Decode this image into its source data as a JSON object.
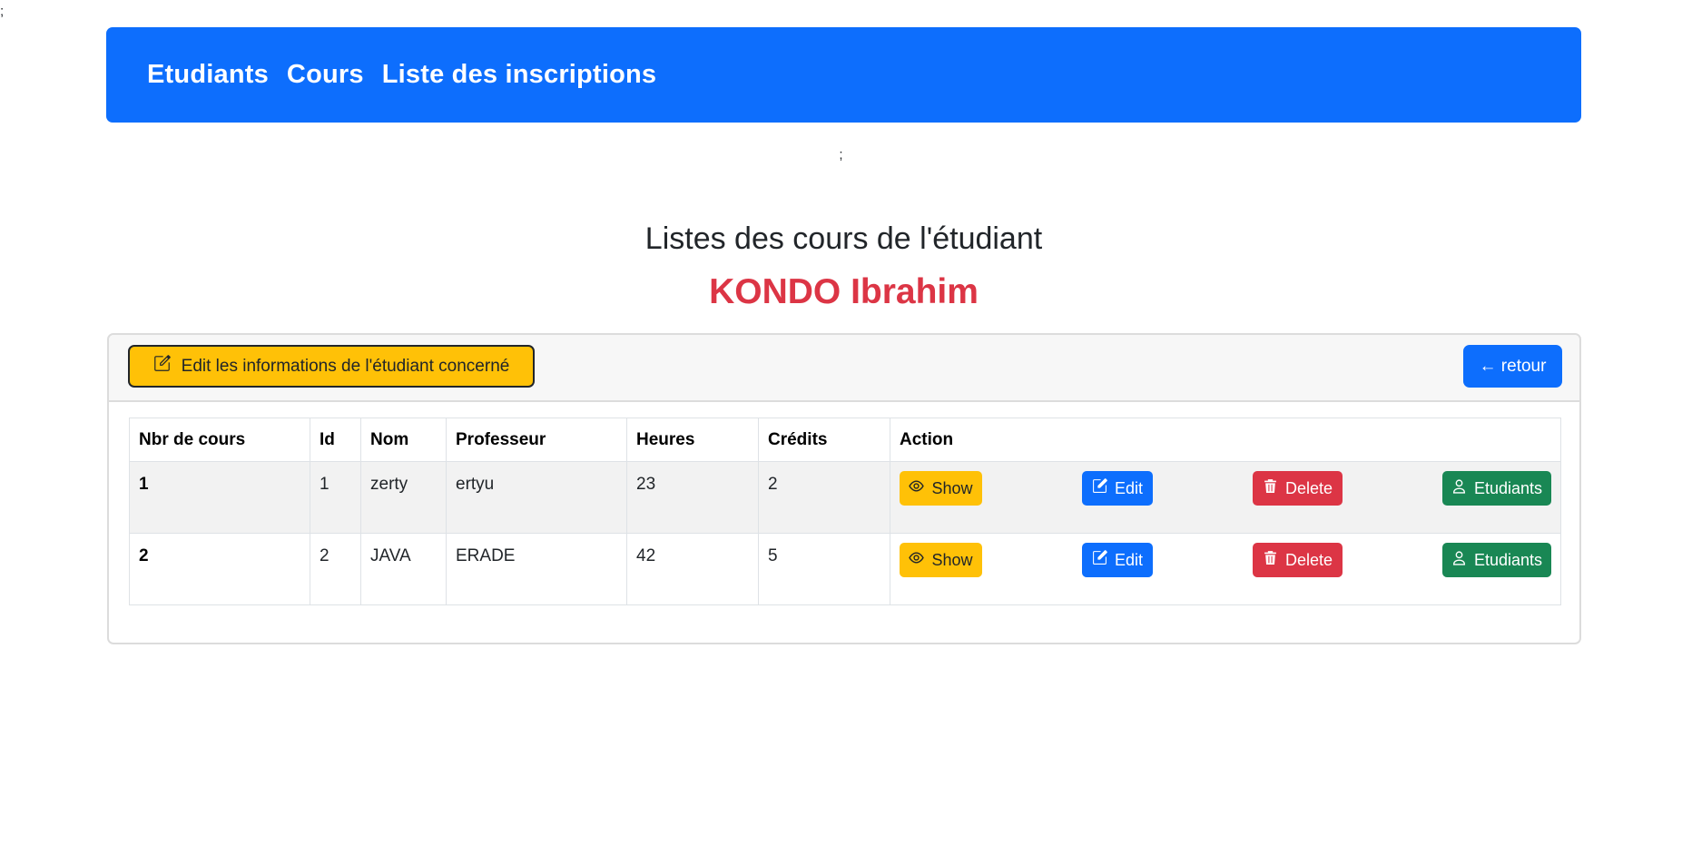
{
  "stray_marks": {
    "top_left": ";",
    "below_nav": ";"
  },
  "navbar": {
    "links": [
      "Etudiants",
      "Cours",
      "Liste des inscriptions"
    ]
  },
  "page": {
    "title": "Listes des cours de l'étudiant",
    "student_name": "KONDO Ibrahim"
  },
  "card_header": {
    "edit_student_label": "Edit les informations de l'étudiant concerné",
    "retour_label": "← retour"
  },
  "table": {
    "headers": [
      "Nbr de cours",
      "Id",
      "Nom",
      "Professeur",
      "Heures",
      "Crédits",
      "Action"
    ],
    "rows": [
      {
        "nbr": "1",
        "id": "1",
        "nom": "zerty",
        "professeur": "ertyu",
        "heures": "23",
        "credits": "2"
      },
      {
        "nbr": "2",
        "id": "2",
        "nom": "JAVA",
        "professeur": "ERADE",
        "heures": "42",
        "credits": "5"
      }
    ],
    "actions": {
      "show": "Show",
      "edit": "Edit",
      "delete": "Delete",
      "etudiants": "Etudiants"
    }
  },
  "colors": {
    "primary": "#0d6efd",
    "warning": "#ffc107",
    "danger": "#dc3545",
    "success": "#198754"
  }
}
